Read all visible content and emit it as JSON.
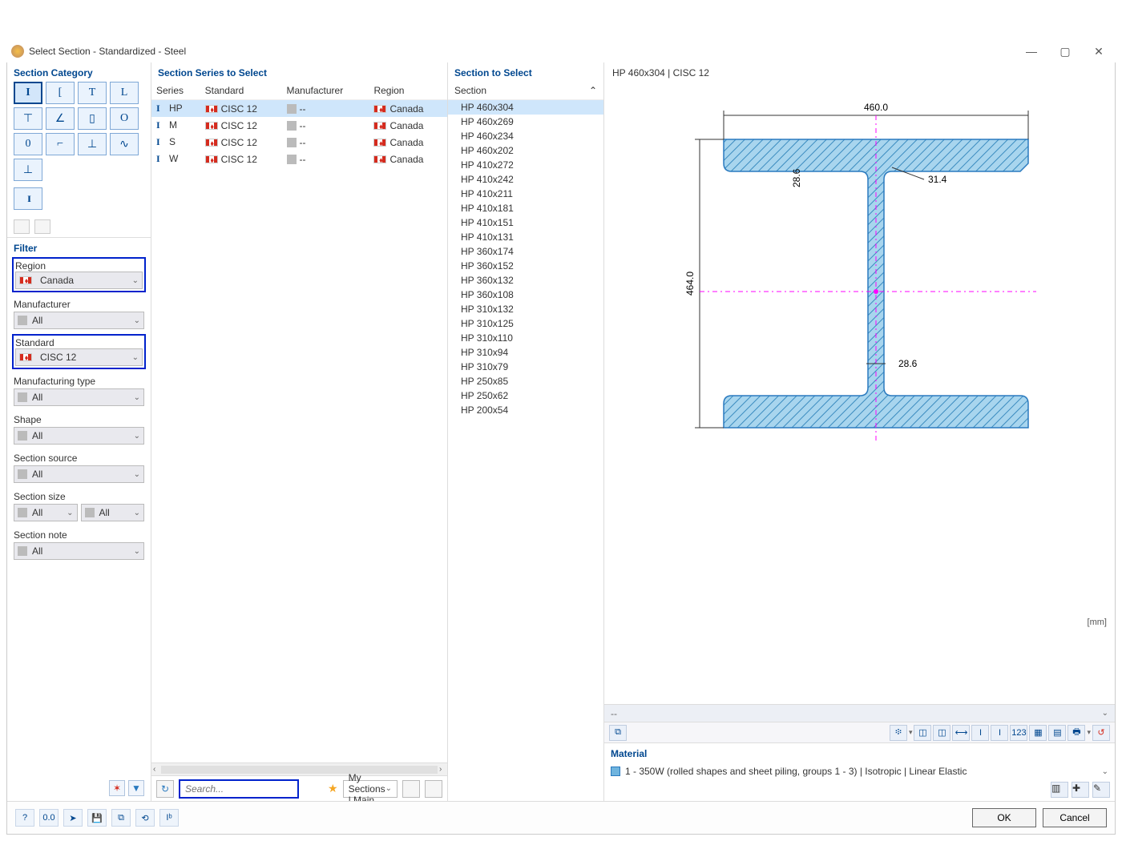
{
  "window": {
    "title": "Select Section - Standardized - Steel"
  },
  "categories": {
    "title": "Section Category",
    "shapes": [
      "I",
      "[",
      "T",
      "L",
      "⊤",
      "∠",
      "▯",
      "O",
      "0",
      "⌐",
      "⊥",
      "∿",
      "⊥"
    ],
    "double_shape": "I I"
  },
  "filter": {
    "title": "Filter",
    "region_label": "Region",
    "region_value": "Canada",
    "manufacturer_label": "Manufacturer",
    "manufacturer_value": "All",
    "standard_label": "Standard",
    "standard_value": "CISC 12",
    "mfg_type_label": "Manufacturing type",
    "mfg_type_value": "All",
    "shape_label": "Shape",
    "shape_value": "All",
    "source_label": "Section source",
    "source_value": "All",
    "size_label": "Section size",
    "size_value1": "All",
    "size_value2": "All",
    "note_label": "Section note",
    "note_value": "All"
  },
  "series": {
    "title": "Section Series to Select",
    "headers": {
      "series": "Series",
      "standard": "Standard",
      "manufacturer": "Manufacturer",
      "region": "Region"
    },
    "rows": [
      {
        "series": "HP",
        "standard": "CISC 12",
        "manufacturer": "--",
        "region": "Canada",
        "selected": true
      },
      {
        "series": "M",
        "standard": "CISC 12",
        "manufacturer": "--",
        "region": "Canada"
      },
      {
        "series": "S",
        "standard": "CISC 12",
        "manufacturer": "--",
        "region": "Canada"
      },
      {
        "series": "W",
        "standard": "CISC 12",
        "manufacturer": "--",
        "region": "Canada"
      }
    ],
    "search_placeholder": "Search...",
    "my_sections": "My Sections | Main"
  },
  "sections": {
    "title": "Section to Select",
    "header": "Section",
    "items": [
      "HP 460x304",
      "HP 460x269",
      "HP 460x234",
      "HP 460x202",
      "HP 410x272",
      "HP 410x242",
      "HP 410x211",
      "HP 410x181",
      "HP 410x151",
      "HP 410x131",
      "HP 360x174",
      "HP 360x152",
      "HP 360x132",
      "HP 360x108",
      "HP 310x132",
      "HP 310x125",
      "HP 310x110",
      "HP 310x94",
      "HP 310x79",
      "HP 250x85",
      "HP 250x62",
      "HP 200x54"
    ],
    "selected": "HP 460x304"
  },
  "preview": {
    "title": "HP 460x304 | CISC 12",
    "unit": "[mm]",
    "dims": {
      "width": "460.0",
      "height": "464.0",
      "tf": "31.4",
      "tw": "28.6",
      "tw2": "28.6"
    },
    "dropdown_placeholder": "--",
    "material_title": "Material",
    "material_value": "1 - 350W (rolled shapes and sheet piling, groups 1 - 3) | Isotropic | Linear Elastic"
  },
  "footer": {
    "ok": "OK",
    "cancel": "Cancel"
  }
}
